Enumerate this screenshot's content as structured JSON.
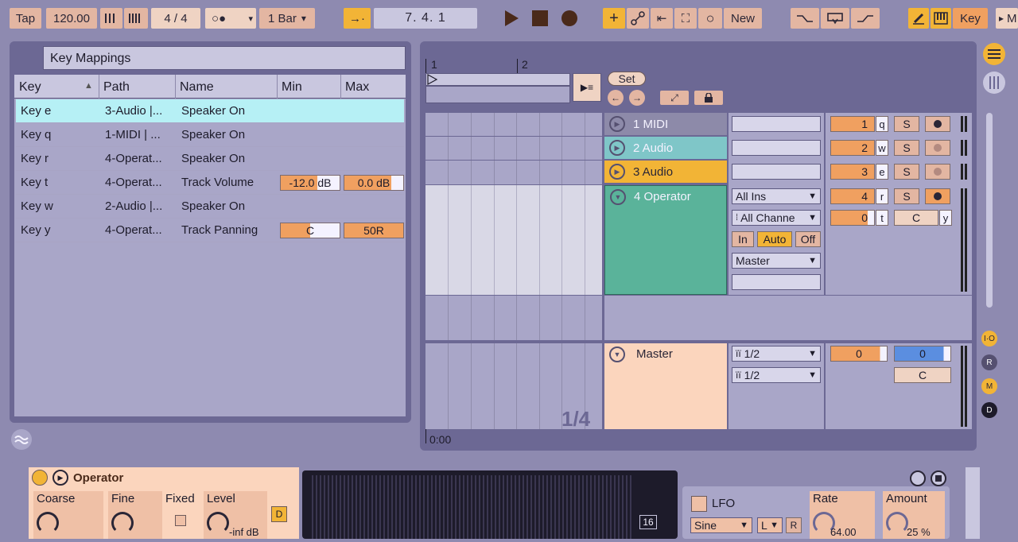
{
  "transport": {
    "tap": "Tap",
    "tempo": "120.00",
    "signature": "4 / 4",
    "quantize": "1 Bar",
    "position": "7.   4.   1",
    "new_label": "New",
    "key_label": "Key",
    "m_label": "M"
  },
  "key_mappings": {
    "title": "Key Mappings",
    "columns": [
      "Key",
      "Path",
      "Name",
      "Min",
      "Max"
    ],
    "rows": [
      {
        "key": "Key e",
        "path": "3-Audio |...",
        "name": "Speaker On",
        "min": "",
        "max": ""
      },
      {
        "key": "Key q",
        "path": "1-MIDI | ...",
        "name": "Speaker On",
        "min": "",
        "max": ""
      },
      {
        "key": "Key r",
        "path": "4-Operat...",
        "name": "Speaker On",
        "min": "",
        "max": ""
      },
      {
        "key": "Key t",
        "path": "4-Operat...",
        "name": "Track Volume",
        "min": "-12.0 dB",
        "max": "0.0 dB"
      },
      {
        "key": "Key w",
        "path": "2-Audio |...",
        "name": "Speaker On",
        "min": "",
        "max": ""
      },
      {
        "key": "Key y",
        "path": "4-Operat...",
        "name": "Track Panning",
        "min": "C",
        "max": "50R"
      }
    ]
  },
  "arrangement": {
    "ruler_1": "1",
    "ruler_2": "2",
    "set_label": "Set",
    "time_label": "0:00",
    "zoom_label": "1/4"
  },
  "tracks": [
    {
      "name": "1 MIDI",
      "num": "1",
      "key": "q",
      "solo": "S",
      "color": "#8d8aa9"
    },
    {
      "name": "2 Audio",
      "num": "2",
      "key": "w",
      "solo": "S",
      "color": "#7fc6c8"
    },
    {
      "name": "3 Audio",
      "num": "3",
      "key": "e",
      "solo": "S",
      "color": "#f2b436"
    },
    {
      "name": "4 Operator",
      "num": "4",
      "key": "r",
      "solo": "S",
      "color": "#5ab39a"
    }
  ],
  "operator_io": {
    "input": "All Ins",
    "channel": "All Channe",
    "monitor_in": "In",
    "monitor_auto": "Auto",
    "monitor_off": "Off",
    "output": "Master",
    "pan_value": "0",
    "pan_key": "t",
    "pan_center": "C",
    "pan_center_key": "y"
  },
  "master": {
    "name": "Master",
    "cue_out": "1/2",
    "master_out": "1/2",
    "vol_a": "0",
    "vol_b": "0",
    "pan": "C"
  },
  "device": {
    "name": "Operator",
    "coarse": "Coarse",
    "fine": "Fine",
    "fixed": "Fixed",
    "level": "Level",
    "level_value": "-inf dB",
    "d_label": "D",
    "lfo": "LFO",
    "lfo_wave": "Sine",
    "lfo_mode": "L",
    "lfo_r": "R",
    "rate": "Rate",
    "rate_value": "64.00",
    "amount": "Amount",
    "amount_value": "25 %",
    "badge": "16"
  },
  "side": {
    "io": "I·O",
    "r": "R",
    "m": "M",
    "d": "D"
  }
}
